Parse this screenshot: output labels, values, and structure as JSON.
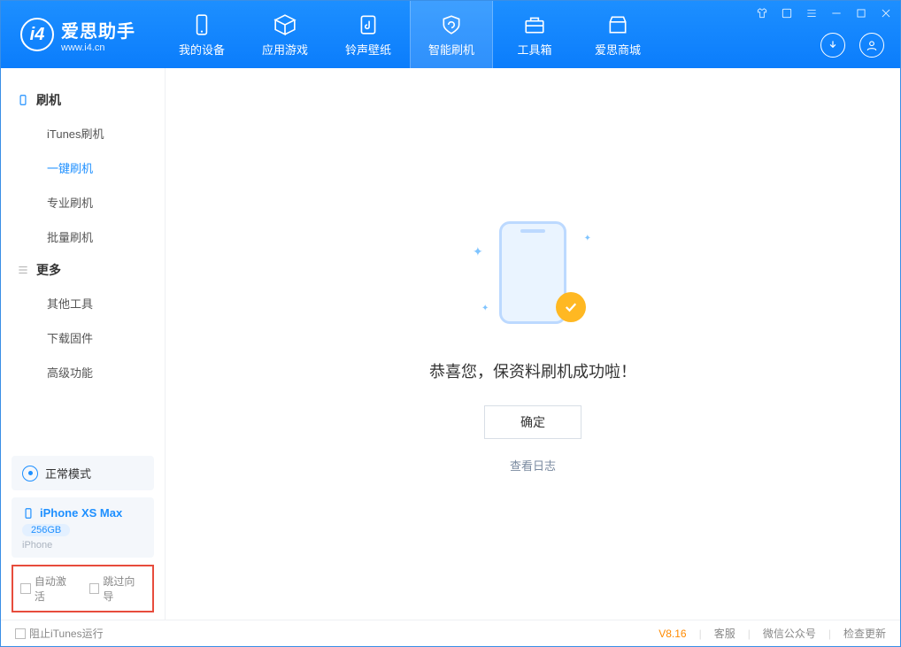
{
  "app": {
    "title": "爱思助手",
    "subtitle": "www.i4.cn"
  },
  "tabs": {
    "device": "我的设备",
    "apps": "应用游戏",
    "ringtone": "铃声壁纸",
    "flash": "智能刷机",
    "toolbox": "工具箱",
    "store": "爱思商城"
  },
  "sidebar": {
    "group_flash": "刷机",
    "items_flash": {
      "itunes": "iTunes刷机",
      "onekey": "一键刷机",
      "pro": "专业刷机",
      "batch": "批量刷机"
    },
    "group_more": "更多",
    "items_more": {
      "other_tools": "其他工具",
      "download_fw": "下载固件",
      "advanced": "高级功能"
    },
    "mode": "正常模式",
    "device": {
      "name": "iPhone XS Max",
      "storage": "256GB",
      "type": "iPhone"
    },
    "checkboxes": {
      "auto_activate": "自动激活",
      "skip_guide": "跳过向导"
    }
  },
  "main": {
    "success": "恭喜您，保资料刷机成功啦！",
    "ok_button": "确定",
    "view_log": "查看日志"
  },
  "footer": {
    "block_itunes": "阻止iTunes运行",
    "version": "V8.16",
    "service": "客服",
    "wechat": "微信公众号",
    "update": "检查更新"
  }
}
